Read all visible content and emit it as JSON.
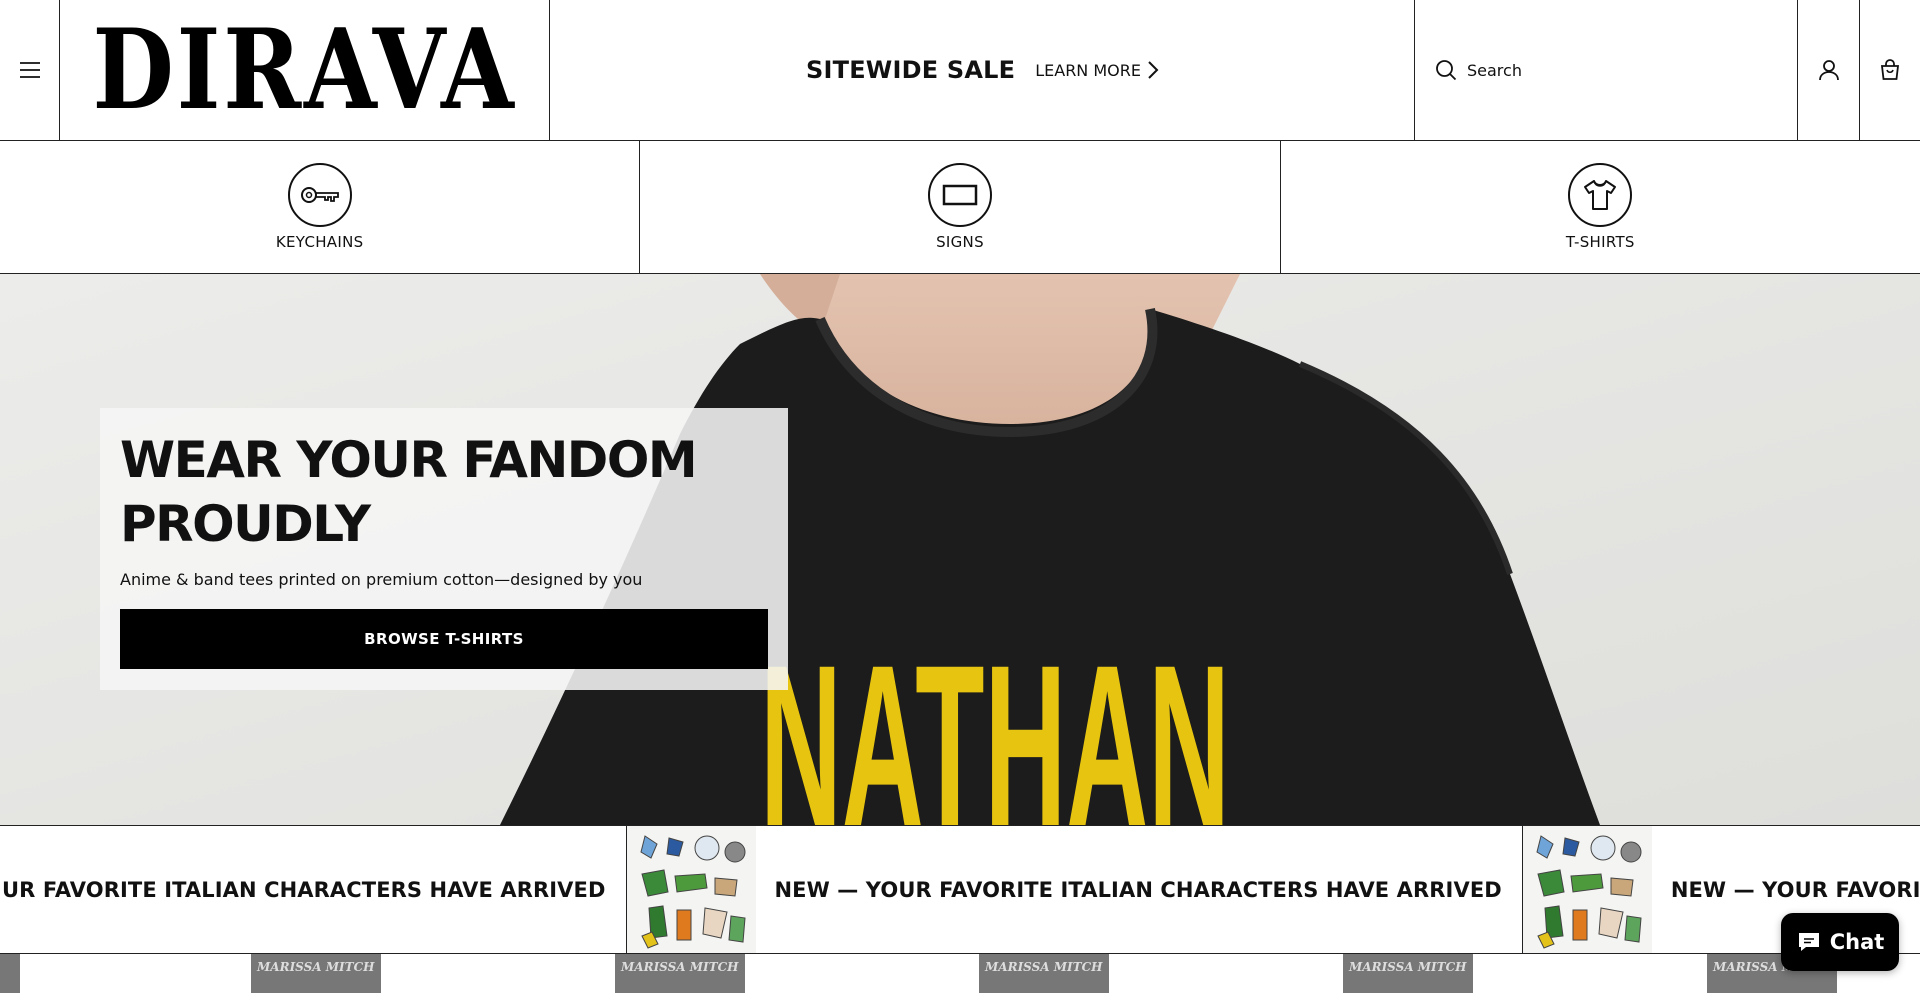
{
  "header": {
    "menu_icon": "hamburger-menu-icon",
    "logo_text": "DIRAVA",
    "promo_title": "SITEWIDE SALE",
    "promo_link": "LEARN MORE",
    "search_placeholder": "Search",
    "account_icon": "user-account-icon",
    "cart_icon": "shopping-bag-icon"
  },
  "categories": [
    {
      "label": "KEYCHAINS",
      "icon": "key-icon"
    },
    {
      "label": "SIGNS",
      "icon": "sign-rectangle-icon"
    },
    {
      "label": "T-SHIRTS",
      "icon": "tshirt-icon"
    }
  ],
  "hero": {
    "title_line1": "WEAR YOUR FANDOM",
    "title_line2": "PROUDLY",
    "subtitle": "Anime & band tees printed on premium cotton—designed by you",
    "button_label": "BROWSE T-SHIRTS",
    "shirt_print": "NATHAN",
    "shirt_color": "#1c1c1c",
    "print_color": "#e6c40f"
  },
  "marquee": {
    "text_partial": "UR FAVORITE ITALIAN CHARACTERS HAVE ARRIVED",
    "text": "NEW — YOUR FAVORITE ITALIAN CHARACTERS HAVE ARRIVED",
    "text_cut": "NEW — YOUR FAVORITE ITALIAN CHARACTERS HAVE A"
  },
  "bottom_strip": {
    "thumb_label_1": "MARISSA",
    "thumb_label_2": "MITCH"
  },
  "chat": {
    "label": "Chat",
    "icon": "chat-bubble-icon",
    "bg_color": "#000000"
  }
}
